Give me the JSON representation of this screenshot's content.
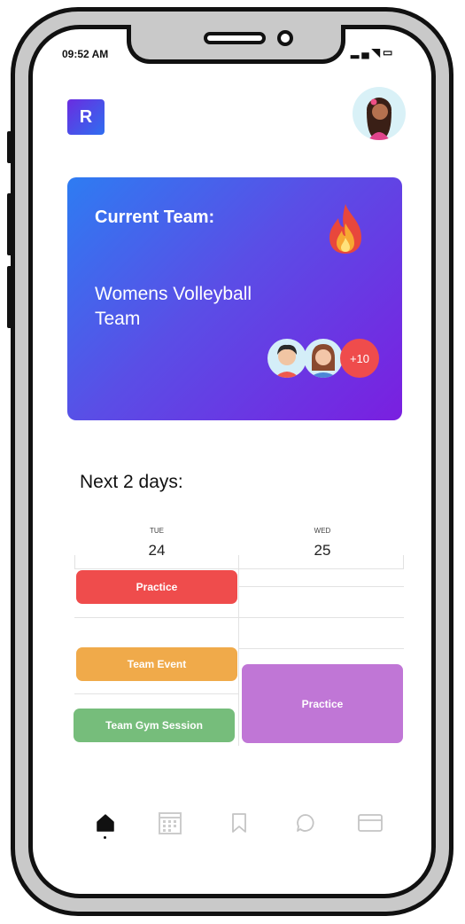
{
  "status_bar": {
    "time": "09:52 AM",
    "icons": [
      "signal-icon",
      "wifi-icon",
      "battery-icon"
    ]
  },
  "header": {
    "logo_letter": "R",
    "avatar": "user-avatar"
  },
  "team_card": {
    "title": "Current Team:",
    "team_name": "Womens Volleyball Team",
    "icon": "flame-icon",
    "more_members": "+10",
    "colors": {
      "gradient_start": "#2e7cf2",
      "gradient_end": "#7a1fe0",
      "badge": "#ef4c4c"
    }
  },
  "schedule": {
    "title": "Next 2 days:",
    "days": [
      {
        "name": "TUE",
        "date": "24"
      },
      {
        "name": "WED",
        "date": "25"
      }
    ],
    "events": [
      {
        "label": "Practice",
        "day": "TUE",
        "color": "#ef4c4c"
      },
      {
        "label": "Team Event",
        "day": "TUE",
        "color": "#f0aa4a"
      },
      {
        "label": "Team Gym Session",
        "day": "TUE",
        "color": "#76bd7b"
      },
      {
        "label": "Practice",
        "day": "WED",
        "color": "#c076d6"
      }
    ]
  },
  "bottom_nav": {
    "items": [
      "home-icon",
      "calendar-icon",
      "bookmark-icon",
      "chat-icon",
      "card-icon"
    ],
    "active": "home-icon"
  }
}
